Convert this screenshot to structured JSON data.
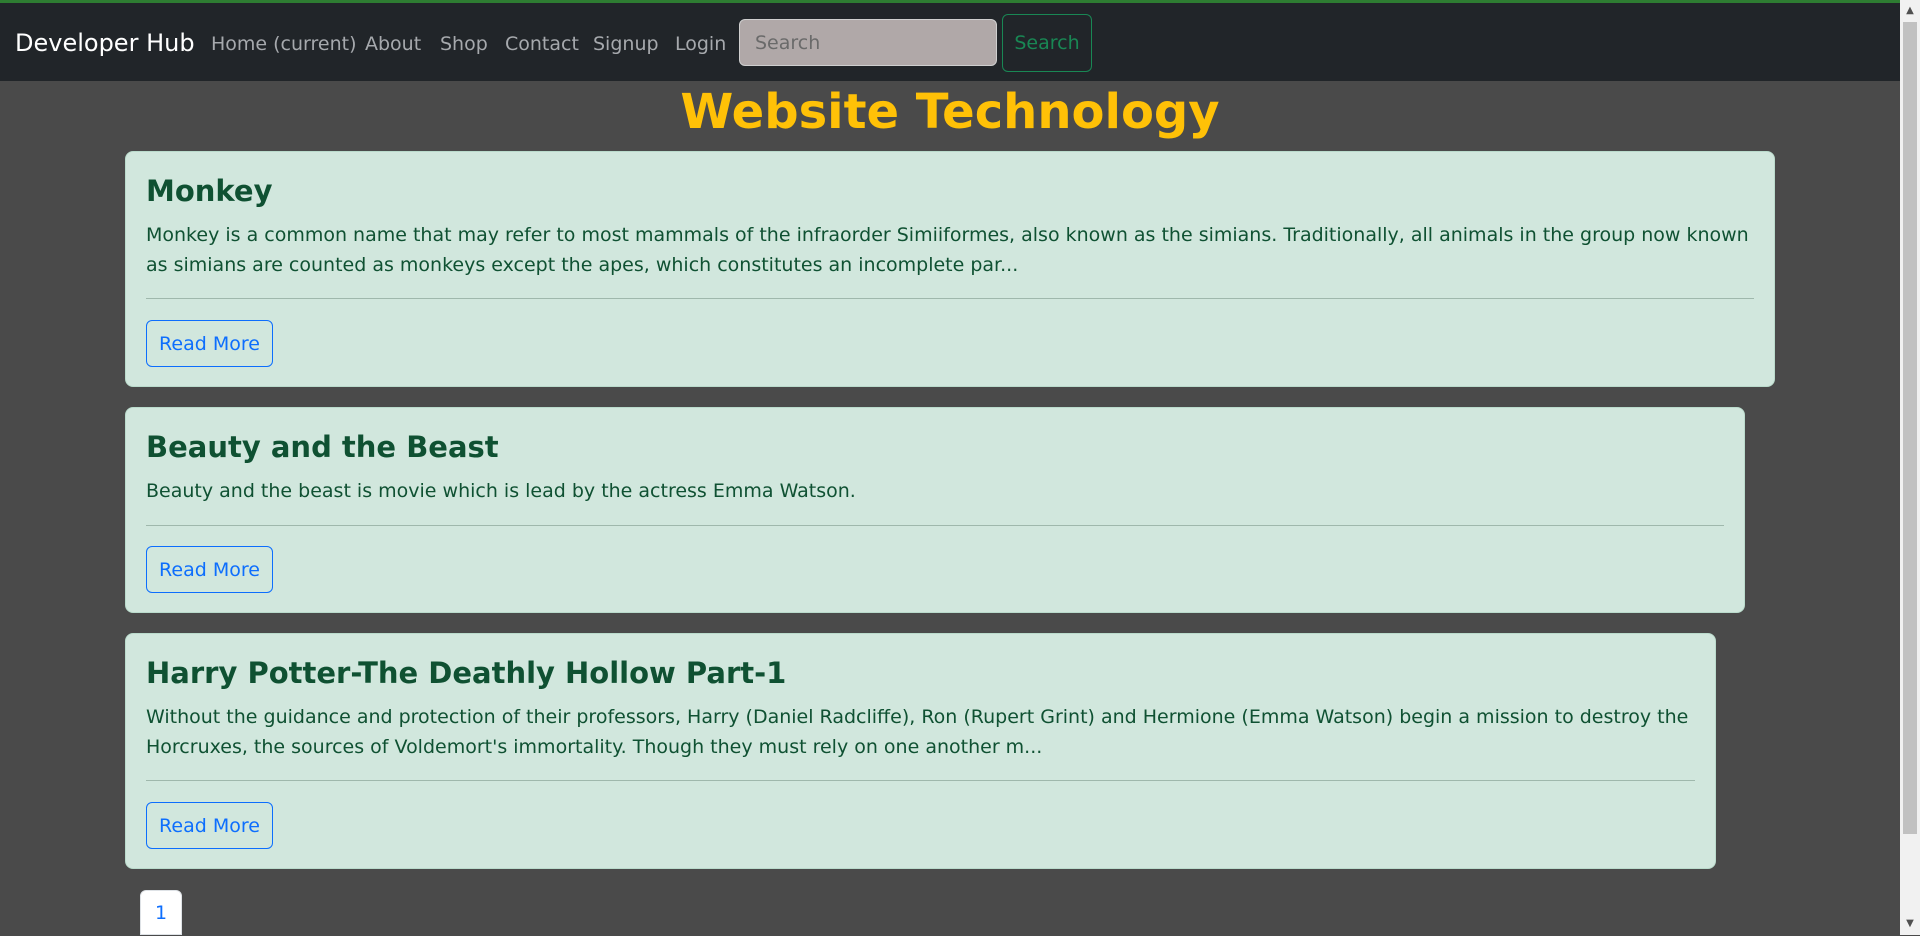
{
  "navbar": {
    "brand": "Developer Hub",
    "links": [
      "Home (current)",
      "About",
      "Shop",
      "Contact",
      "Signup",
      "Login"
    ],
    "search_placeholder": "Search",
    "search_button": "Search"
  },
  "main": {
    "title": "Website Technology",
    "cards": [
      {
        "title": "Monkey",
        "text": "Monkey is a common name that may refer to most mammals of the infraorder Simiiformes, also known as the simians. Traditionally, all animals in the group now known as simians are counted as monkeys except the apes, which constitutes an incomplete par...",
        "button": "Read More"
      },
      {
        "title": "Beauty and the Beast",
        "text": "Beauty and the beast is movie which is lead by the actress Emma Watson.",
        "button": "Read More"
      },
      {
        "title": "Harry Potter-The Deathly Hollow Part-1",
        "text": "Without the guidance and protection of their professors, Harry (Daniel Radcliffe), Ron (Rupert Grint) and Hermione (Emma Watson) begin a mission to destroy the Horcruxes, the sources of Voldemort's immortality. Though they must rely on one another m...",
        "button": "Read More"
      }
    ],
    "pagination": [
      "1"
    ]
  },
  "colors": {
    "navbar_bg": "#212529",
    "title": "#ffc107",
    "card_bg": "#d1e7dd",
    "card_text": "#0f5132",
    "primary": "#0d6efd",
    "success": "#198754"
  }
}
